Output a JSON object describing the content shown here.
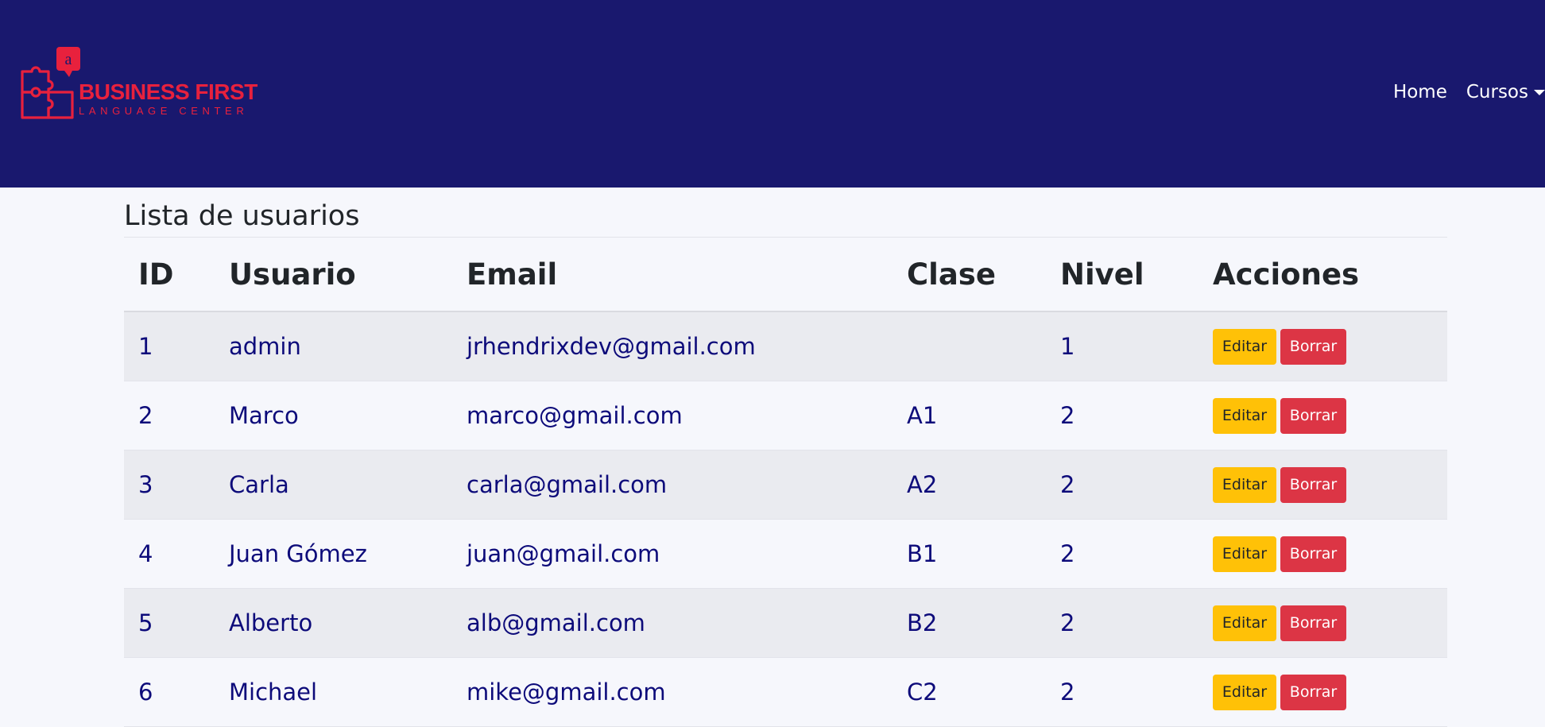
{
  "brand": {
    "logo_letter": "a",
    "name": "BUSINESS FIRST",
    "tagline": "LANGUAGE CENTER",
    "color": "#e8213d"
  },
  "nav": {
    "background": "#19186e",
    "home_label": "Home",
    "courses_label": "Cursos"
  },
  "page": {
    "title": "Lista de usuarios"
  },
  "table": {
    "headers": [
      "ID",
      "Usuario",
      "Email",
      "Clase",
      "Nivel",
      "Acciones"
    ],
    "rows": [
      {
        "id": "1",
        "user": "admin",
        "email": "jrhendrixdev@gmail.com",
        "class": "",
        "level": "1"
      },
      {
        "id": "2",
        "user": "Marco",
        "email": "marco@gmail.com",
        "class": "A1",
        "level": "2"
      },
      {
        "id": "3",
        "user": "Carla",
        "email": "carla@gmail.com",
        "class": "A2",
        "level": "2"
      },
      {
        "id": "4",
        "user": "Juan Gómez",
        "email": "juan@gmail.com",
        "class": "B1",
        "level": "2"
      },
      {
        "id": "5",
        "user": "Alberto",
        "email": "alb@gmail.com",
        "class": "B2",
        "level": "2"
      },
      {
        "id": "6",
        "user": "Michael",
        "email": "mike@gmail.com",
        "class": "C2",
        "level": "2"
      }
    ],
    "edit_label": "Editar",
    "delete_label": "Borrar",
    "edit_color": "#ffc107",
    "delete_color": "#dc3545"
  }
}
